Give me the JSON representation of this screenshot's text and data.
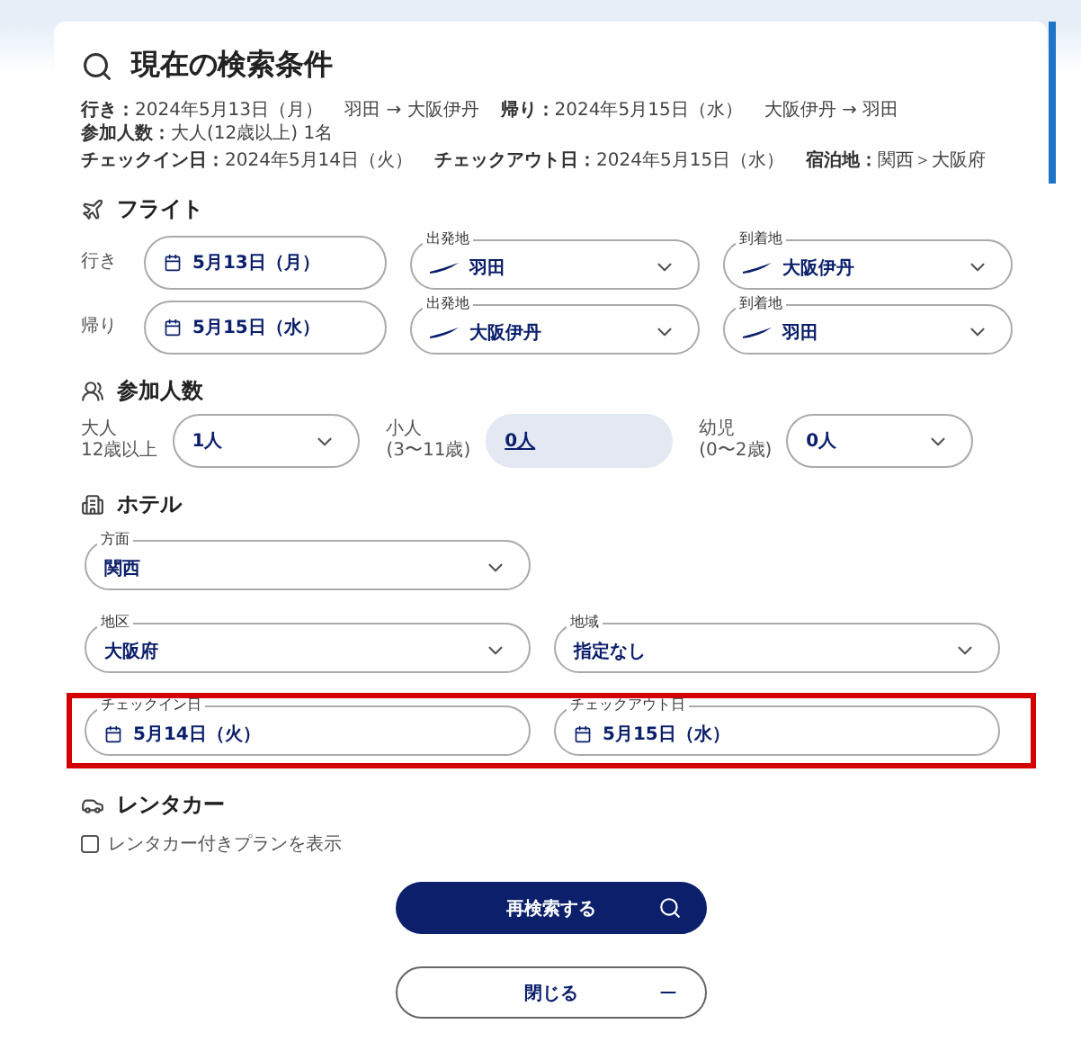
{
  "title": "現在の検索条件",
  "summary": [
    [
      {
        "label": "行き：",
        "value": "2024年5月13日（月）"
      },
      {
        "value": "羽田 → 大阪伊丹"
      },
      {
        "label": "帰り：",
        "value": "2024年5月15日（水）"
      },
      {
        "value": "大阪伊丹 → 羽田"
      },
      {
        "label": "参加人数：",
        "value": "大人(12歳以上) 1名"
      }
    ],
    [
      {
        "label": "チェックイン日：",
        "value": "2024年5月14日（火）"
      },
      {
        "label": "チェックアウト日：",
        "value": "2024年5月15日（水）"
      },
      {
        "label": "宿泊地：",
        "value": "関西＞大阪府"
      }
    ]
  ],
  "flight": {
    "heading": "フライト",
    "rows": [
      {
        "label": "行き",
        "date": "5月13日（月）",
        "from": {
          "label": "出発地",
          "value": "羽田"
        },
        "to": {
          "label": "到着地",
          "value": "大阪伊丹"
        }
      },
      {
        "label": "帰り",
        "date": "5月15日（水）",
        "from": {
          "label": "出発地",
          "value": "大阪伊丹"
        },
        "to": {
          "label": "到着地",
          "value": "羽田"
        }
      }
    ]
  },
  "passengers": {
    "heading": "参加人数",
    "groups": [
      {
        "label_lines": [
          "大人",
          "12歳以上"
        ],
        "value": "1人",
        "highlighted": false
      },
      {
        "label_lines": [
          "小人",
          "(3〜11歳)"
        ],
        "value": "0人",
        "highlighted": true
      },
      {
        "label_lines": [
          "幼児",
          "(0〜2歳)"
        ],
        "value": "0人",
        "highlighted": false
      }
    ]
  },
  "hotel": {
    "heading": "ホテル",
    "rows": [
      {
        "emphasized": false,
        "fields": [
          {
            "kind": "select",
            "label": "方面",
            "value": "関西"
          }
        ]
      },
      {
        "emphasized": false,
        "fields": [
          {
            "kind": "select",
            "label": "地区",
            "value": "大阪府"
          },
          {
            "kind": "select",
            "label": "地域",
            "value": "指定なし"
          }
        ]
      },
      {
        "emphasized": true,
        "fields": [
          {
            "kind": "date",
            "label": "チェックイン日",
            "value": "5月14日（火）"
          },
          {
            "kind": "date",
            "label": "チェックアウト日",
            "value": "5月15日（水）"
          }
        ]
      }
    ]
  },
  "rental_car": {
    "heading": "レンタカー",
    "option": {
      "label": "レンタカー付きプランを表示",
      "checked": false
    }
  },
  "buttons": [
    {
      "kind": "primary",
      "label": "再検索する"
    },
    {
      "kind": "secondary",
      "label": "閉じる"
    }
  ]
}
